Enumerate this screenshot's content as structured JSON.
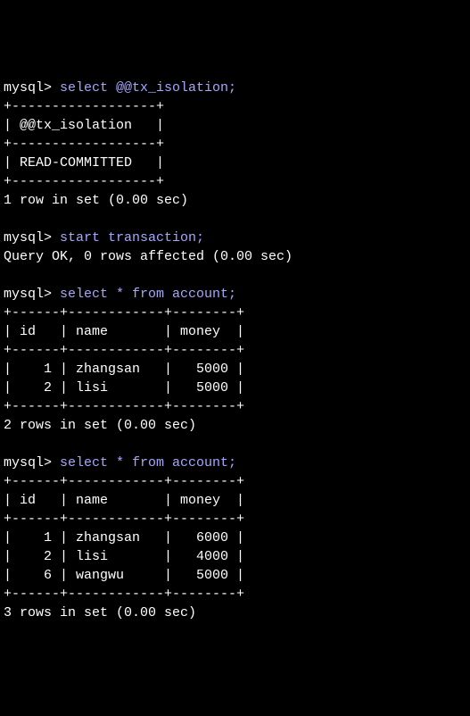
{
  "q1": {
    "prompt": "mysql> ",
    "sql": "select @@tx_isolation;",
    "sep": "+------------------+",
    "header": "| @@tx_isolation   |",
    "row": "| READ-COMMITTED   |",
    "footer": "1 row in set (0.00 sec)"
  },
  "q2": {
    "prompt": "mysql> ",
    "sql": "start transaction;",
    "result": "Query OK, 0 rows affected (0.00 sec)"
  },
  "q3": {
    "prompt": "mysql> ",
    "sql": "select * from account;",
    "sep": "+------+------------+--------+",
    "header": "| id   | name       | money  |",
    "rows": [
      "|    1 | zhangsan   |   5000 |",
      "|    2 | lisi       |   5000 |"
    ],
    "footer": "2 rows in set (0.00 sec)"
  },
  "q4": {
    "prompt": "mysql> ",
    "sql": "select * from account;",
    "sep": "+------+------------+--------+",
    "header": "| id   | name       | money  |",
    "rows": [
      "|    1 | zhangsan   |   6000 |",
      "|    2 | lisi       |   4000 |",
      "|    6 | wangwu     |   5000 |"
    ],
    "footer": "3 rows in set (0.00 sec)"
  }
}
